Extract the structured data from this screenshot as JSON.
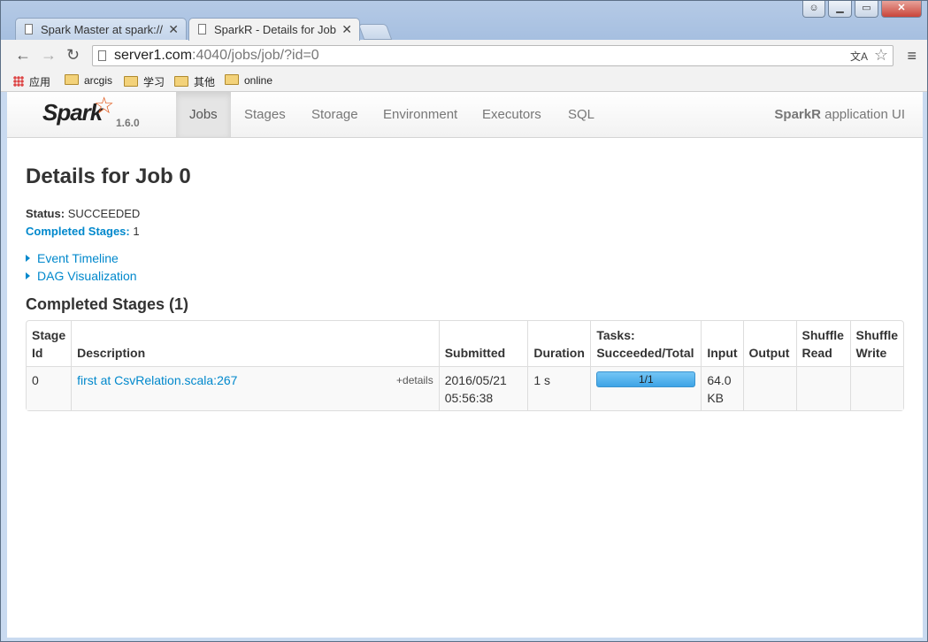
{
  "browser": {
    "tabs": [
      {
        "label": "Spark Master at spark://",
        "active": false
      },
      {
        "label": "SparkR - Details for Job",
        "active": true
      }
    ],
    "url_host": "server1.com",
    "url_rest": ":4040/jobs/job/?id=0",
    "bookmarks": [
      {
        "label": "应用",
        "icon": "apps-icon"
      },
      {
        "label": "arcgis",
        "icon": "folder-icon"
      },
      {
        "label": "学习",
        "icon": "folder-icon"
      },
      {
        "label": "其他",
        "icon": "folder-icon"
      },
      {
        "label": "online",
        "icon": "folder-icon"
      }
    ]
  },
  "navbar": {
    "logo_text": "Spark",
    "version": "1.6.0",
    "links": [
      "Jobs",
      "Stages",
      "Storage",
      "Environment",
      "Executors",
      "SQL"
    ],
    "active_link": "Jobs",
    "app_name_bold": "SparkR",
    "app_name_rest": " application UI"
  },
  "page": {
    "title": "Details for Job 0",
    "status_label": "Status:",
    "status_value": "SUCCEEDED",
    "completed_label": "Completed Stages:",
    "completed_value": "1",
    "event_timeline": "Event Timeline",
    "dag_visualization": "DAG Visualization",
    "completed_header": "Completed Stages (1)"
  },
  "table": {
    "headers": [
      "Stage Id",
      "Description",
      "Submitted",
      "Duration",
      "Tasks: Succeeded/Total",
      "Input",
      "Output",
      "Shuffle Read",
      "Shuffle Write"
    ],
    "rows": [
      {
        "stage_id": "0",
        "description": "first at CsvRelation.scala:267",
        "details": "+details",
        "submitted": "2016/05/21 05:56:38",
        "duration": "1 s",
        "tasks": "1/1",
        "tasks_progress": 1.0,
        "input": "64.0 KB",
        "output": "",
        "shuffle_read": "",
        "shuffle_write": ""
      }
    ]
  }
}
